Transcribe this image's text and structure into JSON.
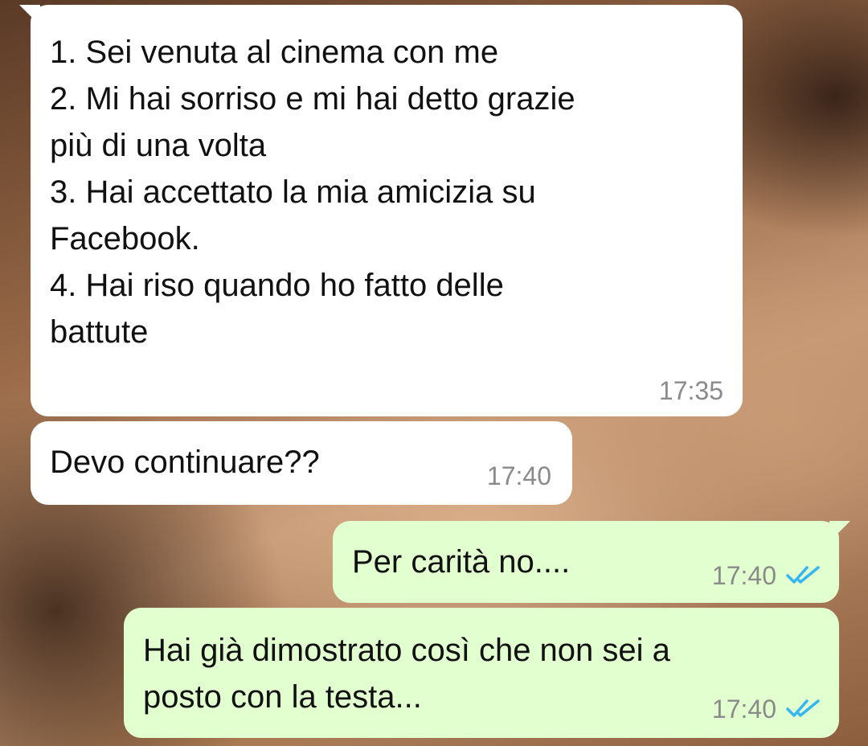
{
  "messages": [
    {
      "direction": "incoming",
      "text": "1. Sei venuta al cinema con me\n2. Mi hai sorriso e mi hai detto grazie\npiù di una volta\n3. Hai accettato la mia amicizia su\nFacebook.\n4. Hai riso quando ho fatto delle\nbattute",
      "time": "17:35"
    },
    {
      "direction": "incoming",
      "text": "Devo continuare??",
      "time": "17:40"
    },
    {
      "direction": "outgoing",
      "text": "Per carità no....",
      "time": "17:40",
      "status_icon": "double-check-read-icon"
    },
    {
      "direction": "outgoing",
      "text": "Hai già dimostrato così che non sei a\nposto con la testa...",
      "time": "17:40",
      "status_icon": "double-check-read-icon"
    }
  ],
  "colors": {
    "incoming_bubble": "#ffffff",
    "outgoing_bubble": "#e2ffd0",
    "timestamp": "#8a8a8a",
    "read_ticks": "#34b7f1"
  }
}
